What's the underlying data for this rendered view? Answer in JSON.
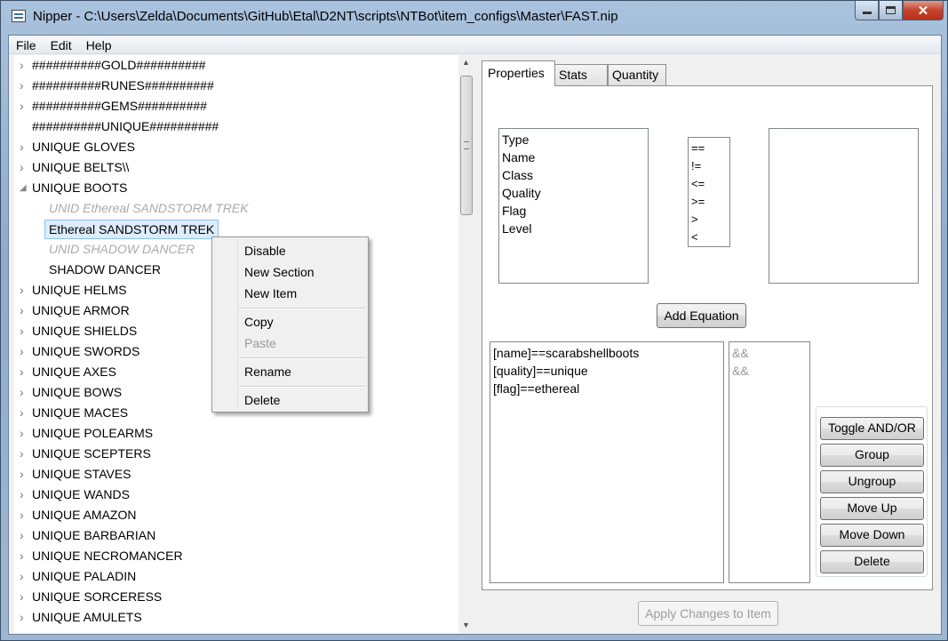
{
  "window": {
    "title": "Nipper - C:\\Users\\Zelda\\Documents\\GitHub\\Etal\\D2NT\\scripts\\NTBot\\item_configs\\Master\\FAST.nip"
  },
  "menu": {
    "file": "File",
    "edit": "Edit",
    "help": "Help"
  },
  "tree": {
    "items": [
      {
        "label": "##########GOLD##########",
        "state": "collapsed"
      },
      {
        "label": "##########RUNES##########",
        "state": "collapsed"
      },
      {
        "label": "##########GEMS##########",
        "state": "collapsed"
      },
      {
        "label": "##########UNIQUE##########",
        "state": "leaf"
      },
      {
        "label": "UNIQUE GLOVES",
        "state": "collapsed"
      },
      {
        "label": "UNIQUE BELTS\\\\",
        "state": "collapsed"
      },
      {
        "label": "UNIQUE BOOTS",
        "state": "expanded"
      },
      {
        "label": "UNID Ethereal SANDSTORM TREK",
        "state": "child-disabled"
      },
      {
        "label": "Ethereal SANDSTORM TREK",
        "state": "child-selected"
      },
      {
        "label": "UNID SHADOW DANCER",
        "state": "child-disabled"
      },
      {
        "label": "SHADOW DANCER",
        "state": "child"
      },
      {
        "label": "UNIQUE HELMS",
        "state": "collapsed"
      },
      {
        "label": "UNIQUE ARMOR",
        "state": "collapsed"
      },
      {
        "label": "UNIQUE SHIELDS",
        "state": "collapsed"
      },
      {
        "label": "UNIQUE SWORDS",
        "state": "collapsed"
      },
      {
        "label": "UNIQUE AXES",
        "state": "collapsed"
      },
      {
        "label": "UNIQUE BOWS",
        "state": "collapsed"
      },
      {
        "label": "UNIQUE MACES",
        "state": "collapsed"
      },
      {
        "label": "UNIQUE POLEARMS",
        "state": "collapsed"
      },
      {
        "label": "UNIQUE SCEPTERS",
        "state": "collapsed"
      },
      {
        "label": "UNIQUE STAVES",
        "state": "collapsed"
      },
      {
        "label": "UNIQUE WANDS",
        "state": "collapsed"
      },
      {
        "label": "UNIQUE AMAZON",
        "state": "collapsed"
      },
      {
        "label": "UNIQUE BARBARIAN",
        "state": "collapsed"
      },
      {
        "label": "UNIQUE NECROMANCER",
        "state": "collapsed"
      },
      {
        "label": "UNIQUE PALADIN",
        "state": "collapsed"
      },
      {
        "label": "UNIQUE SORCERESS",
        "state": "collapsed"
      },
      {
        "label": "UNIQUE AMULETS",
        "state": "collapsed"
      }
    ]
  },
  "context_menu": {
    "disable": "Disable",
    "new_section": "New Section",
    "new_item": "New Item",
    "copy": "Copy",
    "paste": "Paste",
    "rename": "Rename",
    "delete": "Delete"
  },
  "tabs": {
    "properties": "Properties",
    "stats": "Stats",
    "quantity": "Quantity"
  },
  "properties": {
    "fields": [
      "Type",
      "Name",
      "Class",
      "Quality",
      "Flag",
      "Level"
    ],
    "operators": [
      "==",
      "!=",
      "<=",
      ">=",
      ">",
      "<"
    ],
    "add_equation": "Add Equation",
    "equations": [
      "[name]==scarabshellboots",
      "[quality]==unique",
      "[flag]==ethereal"
    ],
    "connectors": [
      "&&",
      "&&"
    ],
    "toggle": "Toggle AND/OR",
    "group": "Group",
    "ungroup": "Ungroup",
    "move_up": "Move Up",
    "move_down": "Move Down",
    "delete": "Delete"
  },
  "apply_button": "Apply Changes to Item",
  "colors": {
    "selection": "#ddecfd",
    "selection_border": "#8ec1ef",
    "disabled_text": "#aaaaaa"
  }
}
